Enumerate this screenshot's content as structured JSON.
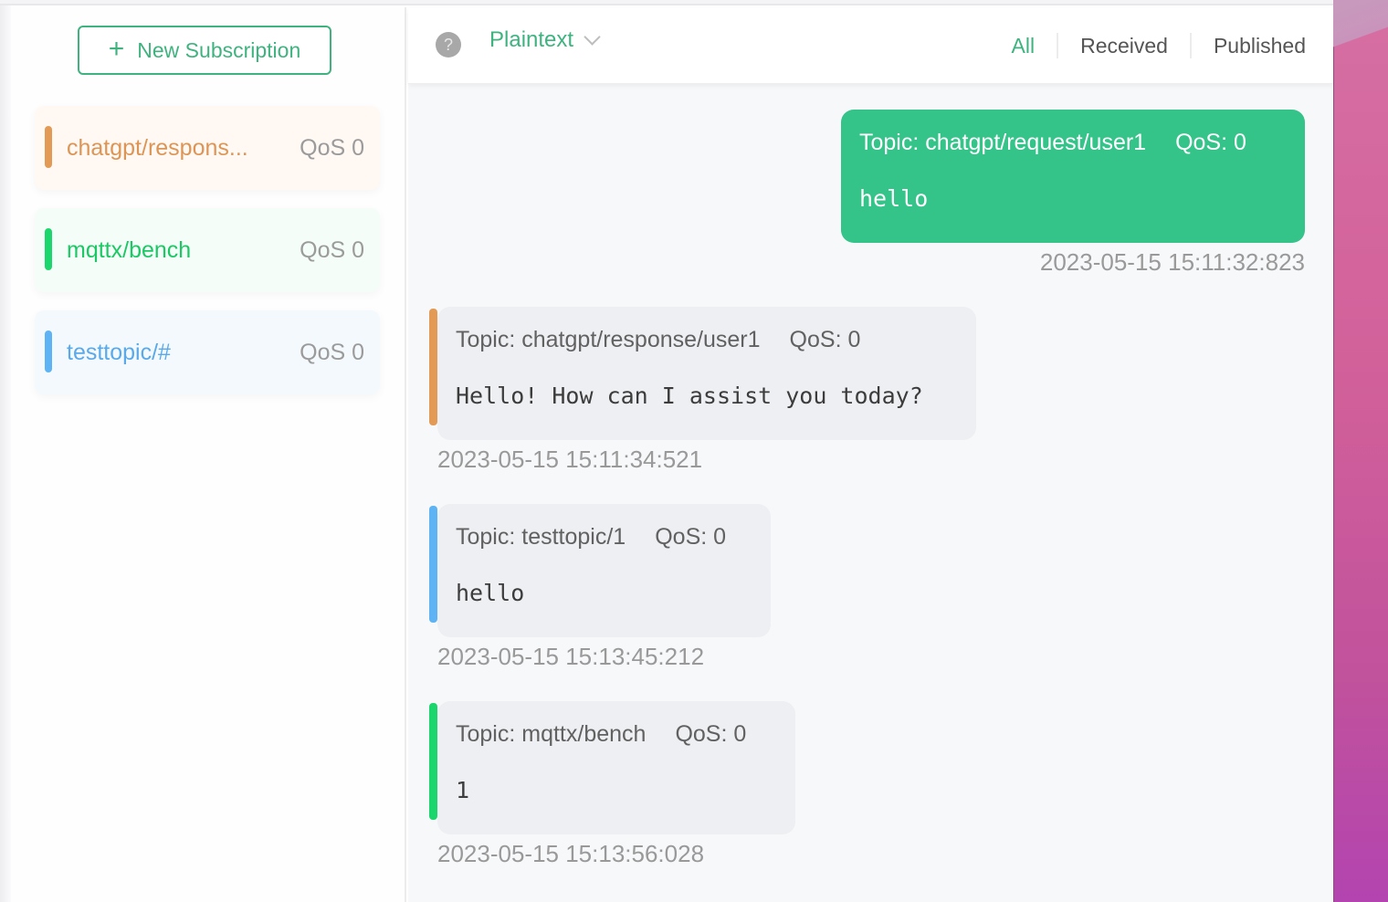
{
  "sidebar": {
    "new_subscription_label": "New Subscription",
    "subscriptions": [
      {
        "topic": "chatgpt/respons...",
        "qos": "QoS 0",
        "color": "#e29a55",
        "bg": "#fff8f3",
        "text_color": "#dc9555"
      },
      {
        "topic": "mqttx/bench",
        "qos": "QoS 0",
        "color": "#1bd66c",
        "bg": "#f4fdf7",
        "text_color": "#1cc865"
      },
      {
        "topic": "testtopic/#",
        "qos": "QoS 0",
        "color": "#5db3f3",
        "bg": "#f4f9fe",
        "text_color": "#5aa9e8"
      }
    ]
  },
  "toolbar": {
    "help_icon": "?",
    "format": "Plaintext",
    "filters": [
      "All",
      "Received",
      "Published"
    ],
    "active_filter": "All"
  },
  "messages": [
    {
      "direction": "out",
      "topic": "Topic: chatgpt/request/user1",
      "qos": "QoS: 0",
      "payload": "hello",
      "time": "2023-05-15 15:11:32:823"
    },
    {
      "direction": "in",
      "topic": "Topic: chatgpt/response/user1",
      "qos": "QoS: 0",
      "payload": "Hello! How can I assist you today?",
      "time": "2023-05-15 15:11:34:521",
      "color": "#e29a55"
    },
    {
      "direction": "in",
      "topic": "Topic: testtopic/1",
      "qos": "QoS: 0",
      "payload": "hello",
      "time": "2023-05-15 15:13:45:212",
      "color": "#5db3f3"
    },
    {
      "direction": "in",
      "topic": "Topic: mqttx/bench",
      "qos": "QoS: 0",
      "payload": "1",
      "time": "2023-05-15 15:13:56:028",
      "color": "#1bd66c"
    }
  ],
  "colors": {
    "accent": "#3fb37f",
    "published_bubble": "#34c388"
  }
}
